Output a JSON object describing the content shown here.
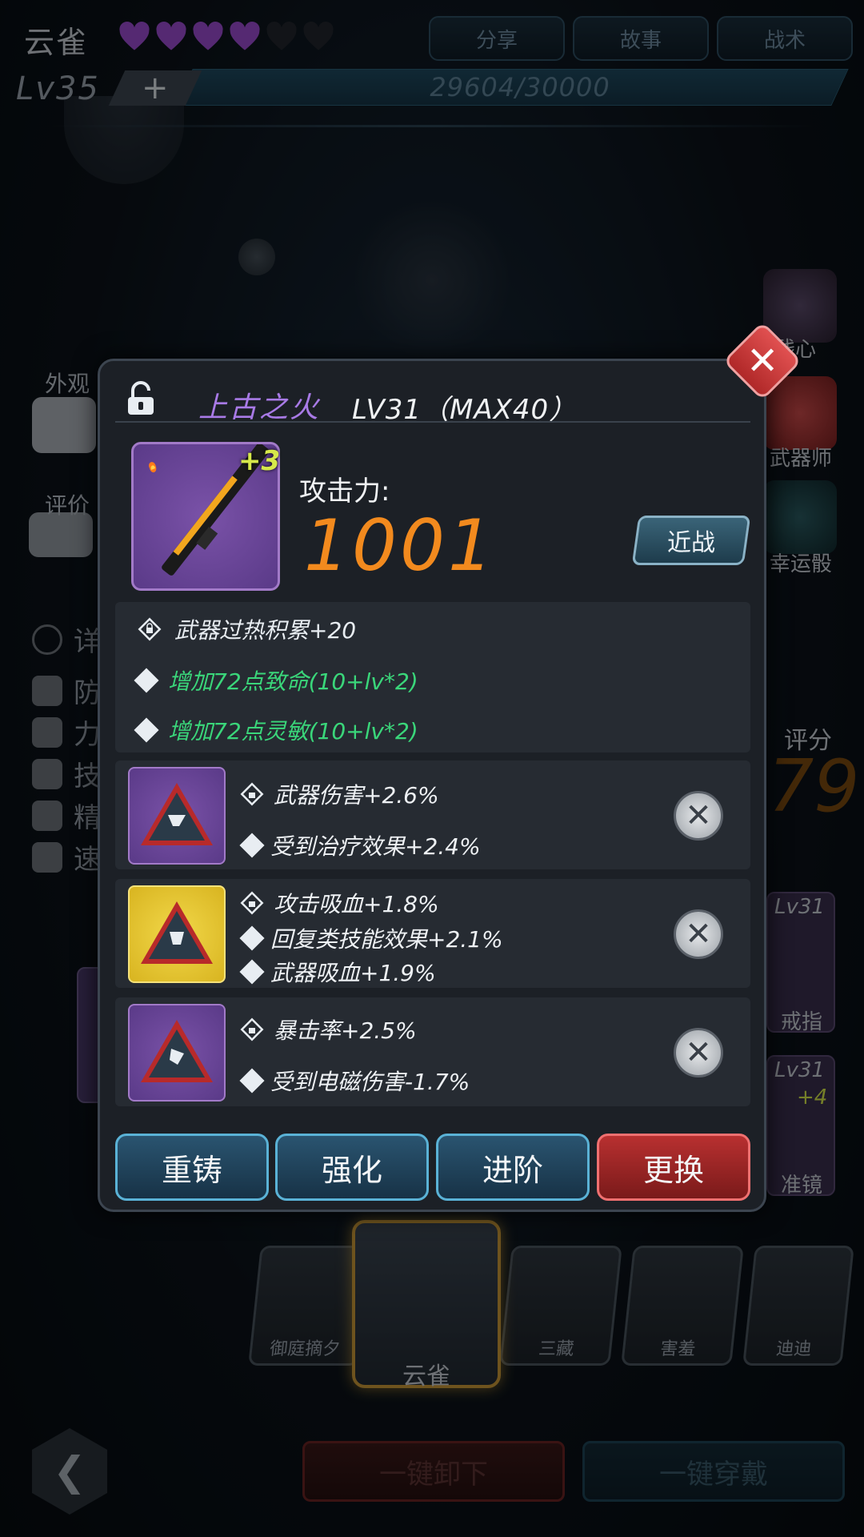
{
  "header": {
    "hero_name": "云雀",
    "hearts_filled": 4,
    "hearts_total": 6,
    "tabs": [
      "分享",
      "故事",
      "战术"
    ],
    "level": "Lv35",
    "plus": "+",
    "exp_text": "29604/30000"
  },
  "left_panel": {
    "appearance": "外观",
    "rating": "评价",
    "detail": "详",
    "stats": [
      "防",
      "力",
      "技",
      "精",
      "速"
    ]
  },
  "right_panel": {
    "items": [
      "残心",
      "武器师",
      "幸运骰"
    ],
    "score_label": "评分",
    "score_value": "79",
    "slots": [
      {
        "level": "Lv31",
        "label": "戒指"
      },
      {
        "level": "Lv31",
        "label": "准镜",
        "bonus": "+4"
      }
    ]
  },
  "modal": {
    "close": "✕",
    "weapon_name": "上古之火",
    "weapon_level": "LV31（MAX40）",
    "upgrade": "+3",
    "attack_label": "攻击力:",
    "attack_value": "1001",
    "weapon_type": "近战",
    "base_stats": [
      {
        "text": "武器过热积累+20",
        "color": "#e8edf2"
      },
      {
        "text": "增加72点致命(10+lv*2)",
        "color": "#3ad67a"
      },
      {
        "text": "增加72点灵敏(10+lv*2)",
        "color": "#3ad67a"
      }
    ],
    "gems": [
      {
        "rarity": "purple",
        "stats": [
          "武器伤害+2.6%",
          "受到治疗效果+2.4%"
        ]
      },
      {
        "rarity": "gold",
        "stats": [
          "攻击吸血+1.8%",
          "回复类技能效果+2.1%",
          "武器吸血+1.9%"
        ]
      },
      {
        "rarity": "purple",
        "stats": [
          "暴击率+2.5%",
          "受到电磁伤害-1.7%"
        ]
      }
    ],
    "remove": "✕",
    "actions": [
      "重铸",
      "强化",
      "进阶",
      "更换"
    ]
  },
  "heroes": {
    "list": [
      "御庭摘夕",
      "云雀",
      "三藏",
      "害羞",
      "迪迪"
    ],
    "selected": "云雀"
  },
  "footer": {
    "back": "❮",
    "unload_all": "一键卸下",
    "wear_all": "一键穿戴"
  },
  "colors": {
    "accent_orange": "#f28a1e",
    "weapon_purple": "#a87ae6",
    "stat_green": "#3ad67a",
    "button_blue": "#5ab2d6",
    "button_red": "#f07070"
  }
}
